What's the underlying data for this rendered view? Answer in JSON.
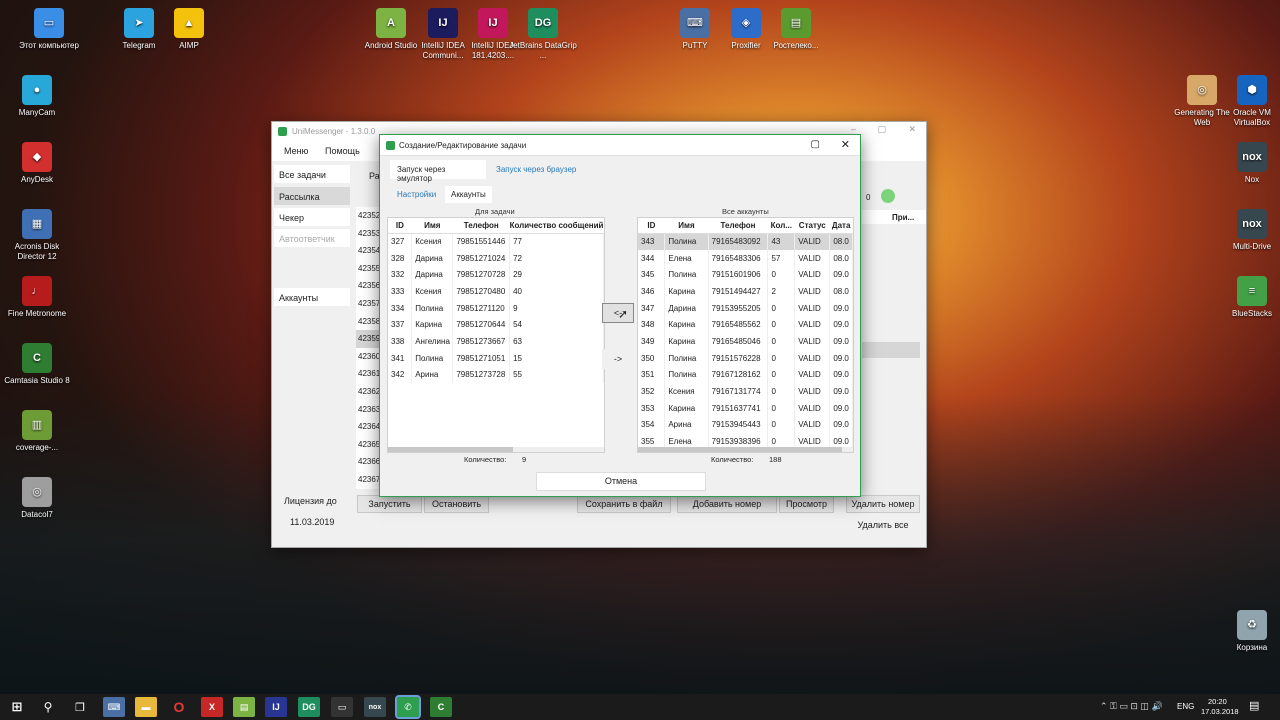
{
  "desktop_icons": [
    {
      "label": "Этот компьютер",
      "name": "this-pc-icon",
      "color": "#3a8ee6",
      "glyph": "▭"
    },
    {
      "label": "Telegram",
      "name": "telegram-icon",
      "color": "#2aa3df",
      "glyph": "➤"
    },
    {
      "label": "AIMP",
      "name": "aimp-icon",
      "color": "#f4c20d",
      "glyph": "▲"
    },
    {
      "label": "Android Studio",
      "name": "android-studio-icon",
      "color": "#7cb342",
      "glyph": "A"
    },
    {
      "label": "IntelliJ IDEA Communi...",
      "name": "intellij-icon",
      "color": "#1b1b5e",
      "glyph": "IJ"
    },
    {
      "label": "IntelliJ IDEA 181.4203....",
      "name": "intellij2-icon",
      "color": "#c2185b",
      "glyph": "IJ"
    },
    {
      "label": "JetBrains DataGrip ...",
      "name": "datagrip-icon",
      "color": "#1e8e5e",
      "glyph": "DG"
    },
    {
      "label": "PuTTY",
      "name": "putty-icon",
      "color": "#4a6fa5",
      "glyph": "⌨"
    },
    {
      "label": "Proxifier",
      "name": "proxifier-icon",
      "color": "#2e6cc9",
      "glyph": "◈"
    },
    {
      "label": "Ростелеко...",
      "name": "rostelecom-icon",
      "color": "#5b9a2e",
      "glyph": "▤"
    },
    {
      "label": "ManyCam",
      "name": "manycam-icon",
      "color": "#28a8d8",
      "glyph": "●"
    },
    {
      "label": "AnyDesk",
      "name": "anydesk-icon",
      "color": "#d32f2f",
      "glyph": "◆"
    },
    {
      "label": "Acronis Disk Director 12",
      "name": "acronis-icon",
      "color": "#3f6fb5",
      "glyph": "▦"
    },
    {
      "label": "Fine Metronome",
      "name": "metronome-icon",
      "color": "#b71c1c",
      "glyph": "♩"
    },
    {
      "label": "Camtasia Studio 8",
      "name": "camtasia-icon",
      "color": "#2e7d32",
      "glyph": "C"
    },
    {
      "label": "coverage-...",
      "name": "coverage-icon",
      "color": "#6d9b35",
      "glyph": "▥"
    },
    {
      "label": "Datacol7",
      "name": "datacol-icon",
      "color": "#9e9e9e",
      "glyph": "◎"
    },
    {
      "label": "Generating The Web",
      "name": "generating-web-icon",
      "color": "#d7a868",
      "glyph": "◎"
    },
    {
      "label": "Oracle VM VirtualBox",
      "name": "virtualbox-icon",
      "color": "#1565c0",
      "glyph": "⬢"
    },
    {
      "label": "Nox",
      "name": "nox-icon",
      "color": "#37474f",
      "glyph": "nox"
    },
    {
      "label": "Multi-Drive",
      "name": "multi-drive-icon",
      "color": "#37474f",
      "glyph": "nox"
    },
    {
      "label": "BlueStacks",
      "name": "bluestacks-icon",
      "color": "#43a047",
      "glyph": "≡"
    },
    {
      "label": "Корзина",
      "name": "recycle-bin-icon",
      "color": "#90a4ae",
      "glyph": "♻"
    }
  ],
  "main_window": {
    "title": "UniMessenger - 1.3.0.0",
    "menu": [
      "Меню",
      "Помощь"
    ],
    "nav": [
      "Все задачи",
      "Рассылка",
      "Чекер",
      "Автоответчик",
      "Аккаунты"
    ],
    "license_label": "Лицензия до",
    "license_date": "11.03.2019",
    "partial_tab": "Ра",
    "col_header": "При...",
    "count_zero": "0",
    "ids": [
      "42352",
      "42353",
      "42354",
      "42355",
      "42356",
      "42357",
      "42358",
      "42359",
      "42360",
      "42361",
      "42362",
      "42363",
      "42364",
      "42365",
      "42366",
      "42367"
    ],
    "buttons": {
      "start": "Запустить",
      "stop": "Остановить",
      "save_file": "Сохранить в файл",
      "add_number": "Добавить номер",
      "view": "Просмотр",
      "delete_number": "Удалить номер",
      "delete_all": "Удалить все"
    }
  },
  "dialog": {
    "title": "Создание/Редактирование задачи",
    "tabs": [
      "Запуск через эмулятор",
      "Запуск через браузер"
    ],
    "subtabs": [
      "Настройки",
      "Аккаунты"
    ],
    "left_caption": "Для задачи",
    "right_caption": "Все аккаунты",
    "left_headers": [
      "ID",
      "Имя",
      "Телефон",
      "Количество сообщений"
    ],
    "left_rows": [
      [
        "327",
        "Ксения",
        "79851551446",
        "77"
      ],
      [
        "328",
        "Дарина",
        "79851271024",
        "72"
      ],
      [
        "332",
        "Дарина",
        "79851270728",
        "29"
      ],
      [
        "333",
        "Ксения",
        "79851270480",
        "40"
      ],
      [
        "334",
        "Полина",
        "79851271120",
        "9"
      ],
      [
        "337",
        "Карина",
        "79851270644",
        "54"
      ],
      [
        "338",
        "Ангелина",
        "79851273667",
        "63"
      ],
      [
        "341",
        "Полина",
        "79851271051",
        "15"
      ],
      [
        "342",
        "Арина",
        "79851273728",
        "55"
      ]
    ],
    "right_headers": [
      "ID",
      "Имя",
      "Телефон",
      "Кол...",
      "Статус",
      "Дата"
    ],
    "right_rows": [
      [
        "343",
        "Полина",
        "79165483092",
        "43",
        "VALID",
        "08.0"
      ],
      [
        "344",
        "Елена",
        "79165483306",
        "57",
        "VALID",
        "08.0"
      ],
      [
        "345",
        "Полина",
        "79151601906",
        "0",
        "VALID",
        "09.0"
      ],
      [
        "346",
        "Карина",
        "79151494427",
        "2",
        "VALID",
        "08.0"
      ],
      [
        "347",
        "Дарина",
        "79153955205",
        "0",
        "VALID",
        "09.0"
      ],
      [
        "348",
        "Карина",
        "79165485562",
        "0",
        "VALID",
        "09.0"
      ],
      [
        "349",
        "Карина",
        "79165485046",
        "0",
        "VALID",
        "09.0"
      ],
      [
        "350",
        "Полина",
        "79151576228",
        "0",
        "VALID",
        "09.0"
      ],
      [
        "351",
        "Полина",
        "79167128162",
        "0",
        "VALID",
        "09.0"
      ],
      [
        "352",
        "Ксения",
        "79167131774",
        "0",
        "VALID",
        "09.0"
      ],
      [
        "353",
        "Карина",
        "79151637741",
        "0",
        "VALID",
        "09.0"
      ],
      [
        "354",
        "Арина",
        "79153945443",
        "0",
        "VALID",
        "09.0"
      ],
      [
        "355",
        "Елена",
        "79153938396",
        "0",
        "VALID",
        "09.0"
      ]
    ],
    "left_count_label": "Количество:",
    "left_count": "9",
    "right_count_label": "Количество:",
    "right_count": "188",
    "move_left": "<-",
    "move_right": "->",
    "cancel": "Отмена"
  },
  "taskbar": {
    "lang": "ENG",
    "time": "20:20",
    "date": "17.03.2018"
  }
}
